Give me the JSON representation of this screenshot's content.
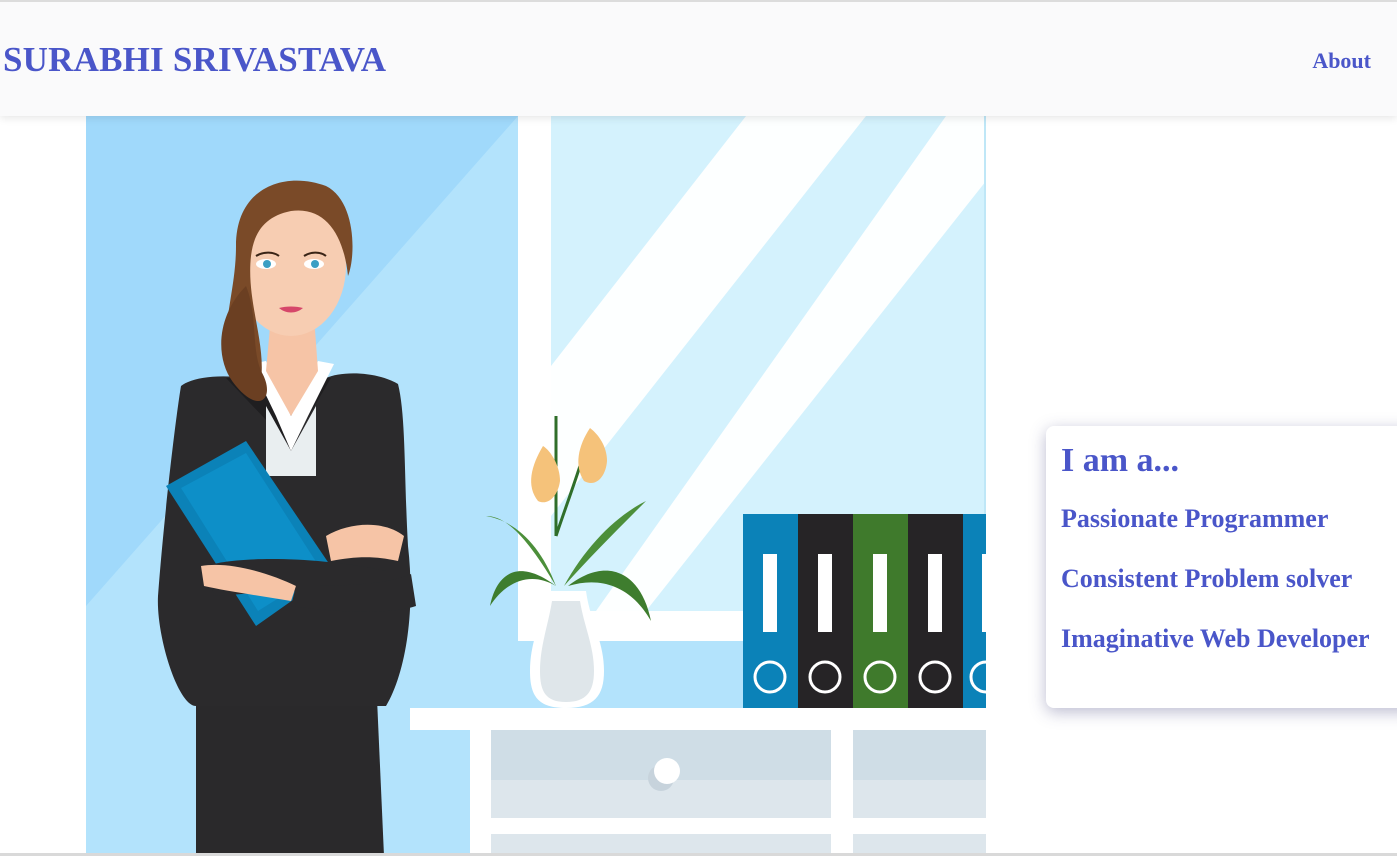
{
  "navbar": {
    "brand": "SURABHI SRIVASTAVA",
    "links": [
      {
        "label": "About"
      }
    ]
  },
  "hero": {
    "illustration": "businesswoman-office-illustration"
  },
  "card": {
    "title": "I am a...",
    "items": [
      "Passionate Programmer",
      "Consistent Problem solver",
      "Imaginative Web Developer"
    ]
  },
  "colors": {
    "accent": "#4a56c9",
    "navbar_bg": "#fafafb",
    "sky": "#a8dcfb",
    "suit": "#2b2a2c",
    "folder_blue": "#0a7fb5"
  }
}
